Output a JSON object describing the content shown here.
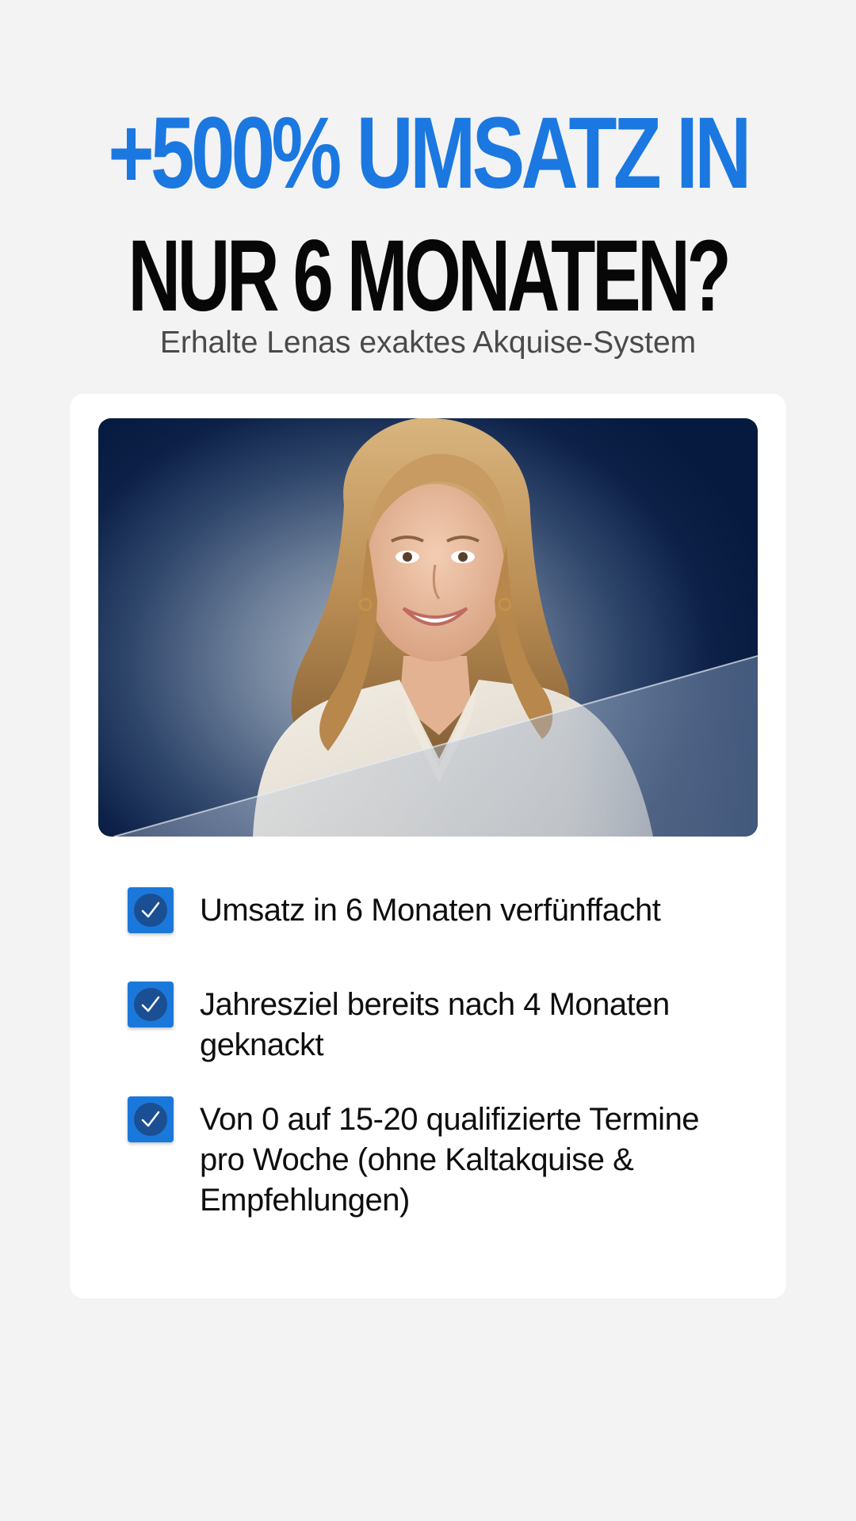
{
  "headline": {
    "line1": "+500% UMSATZ IN",
    "line2": "NUR 6 MONATEN?"
  },
  "subtitle": "Erhalte Lenas exaktes Akquise-System",
  "colors": {
    "accent": "#1b78e0",
    "headline_dark": "#070707",
    "background": "#f3f3f3",
    "card": "#ffffff",
    "checkbox": "#1b78db",
    "photo_navy": "#061a3f"
  },
  "photo": {
    "icon": "portrait-photo"
  },
  "benefits": [
    {
      "text": "Umsatz in 6 Monaten verfünffacht",
      "icon": "checkbox-checked-icon"
    },
    {
      "text": "Jahresziel bereits nach 4 Monaten geknackt",
      "icon": "checkbox-checked-icon"
    },
    {
      "text": "Von 0 auf 15-20 qualifizierte Termine pro Woche (ohne Kaltakquise & Empfehlungen)",
      "icon": "checkbox-checked-icon"
    }
  ]
}
